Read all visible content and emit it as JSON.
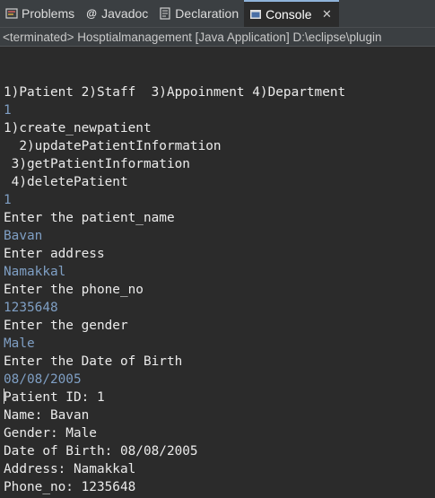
{
  "tabs": [
    {
      "label": "Problems",
      "icon": "problems-icon",
      "active": false
    },
    {
      "label": "Javadoc",
      "icon": "javadoc-icon",
      "active": false
    },
    {
      "label": "Declaration",
      "icon": "declaration-icon",
      "active": false
    },
    {
      "label": "Console",
      "icon": "console-icon",
      "active": true
    }
  ],
  "status": "<terminated> Hosptialmanagement [Java Application] D:\\eclipse\\plugin",
  "colors": {
    "output": "#ebebeb",
    "input": "#7f9fc4",
    "background": "#2b2b2b"
  },
  "console_lines": [
    {
      "text": "1)Patient 2)Staff  3)Appoinment 4)Department",
      "kind": "out"
    },
    {
      "text": "1",
      "kind": "in"
    },
    {
      "text": "1)create_newpatient",
      "kind": "out"
    },
    {
      "text": "  2)updatePatientInformation",
      "kind": "out"
    },
    {
      "text": " 3)getPatientInformation",
      "kind": "out"
    },
    {
      "text": " 4)deletePatient",
      "kind": "out"
    },
    {
      "text": "1",
      "kind": "in"
    },
    {
      "text": "Enter the patient_name",
      "kind": "out"
    },
    {
      "text": "Bavan",
      "kind": "in"
    },
    {
      "text": "Enter address",
      "kind": "out"
    },
    {
      "text": "Namakkal",
      "kind": "in"
    },
    {
      "text": "Enter the phone_no",
      "kind": "out"
    },
    {
      "text": "1235648",
      "kind": "in"
    },
    {
      "text": "Enter the gender",
      "kind": "out"
    },
    {
      "text": "Male",
      "kind": "in"
    },
    {
      "text": "Enter the Date of Birth",
      "kind": "out"
    },
    {
      "text": "08/08/2005",
      "kind": "in"
    },
    {
      "text": "Patient ID: 1",
      "kind": "out"
    },
    {
      "text": "Name: Bavan",
      "kind": "out"
    },
    {
      "text": "Gender: Male",
      "kind": "out"
    },
    {
      "text": "Date of Birth: 08/08/2005",
      "kind": "out"
    },
    {
      "text": "Address: Namakkal",
      "kind": "out"
    },
    {
      "text": "Phone_no: 1235648",
      "kind": "out"
    }
  ]
}
